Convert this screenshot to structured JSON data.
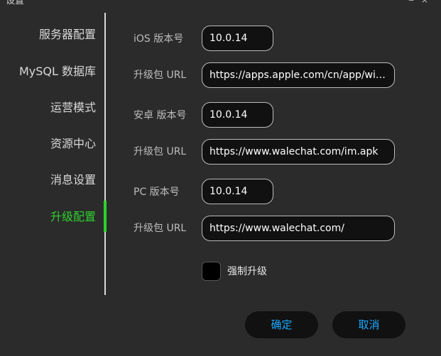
{
  "window": {
    "title": "设置",
    "close_glyph": "×"
  },
  "sidebar": {
    "items": [
      {
        "label": "服务器配置"
      },
      {
        "label": "MySQL 数据库"
      },
      {
        "label": "运营模式"
      },
      {
        "label": "资源中心"
      },
      {
        "label": "消息设置"
      },
      {
        "label": "升级配置"
      }
    ],
    "active_index": 5
  },
  "form": {
    "ios_version_label": "iOS 版本号",
    "ios_version": "10.0.14",
    "ios_url_label": "升级包 URL",
    "ios_url": "https://apps.apple.com/cn/app/wineim...",
    "android_version_label": "安卓 版本号",
    "android_version": "10.0.14",
    "android_url_label": "升级包 URL",
    "android_url": "https://www.walechat.com/im.apk",
    "pc_version_label": "PC 版本号",
    "pc_version": "10.0.14",
    "pc_url_label": "升级包 URL",
    "pc_url": "https://www.walechat.com/",
    "force_upgrade_label": "强制升级",
    "force_upgrade_checked": false
  },
  "buttons": {
    "ok": "确定",
    "cancel": "取消"
  },
  "colors": {
    "accent": "#2ed12e",
    "button_text": "#19a9ff",
    "background": "#2b2b2b"
  }
}
